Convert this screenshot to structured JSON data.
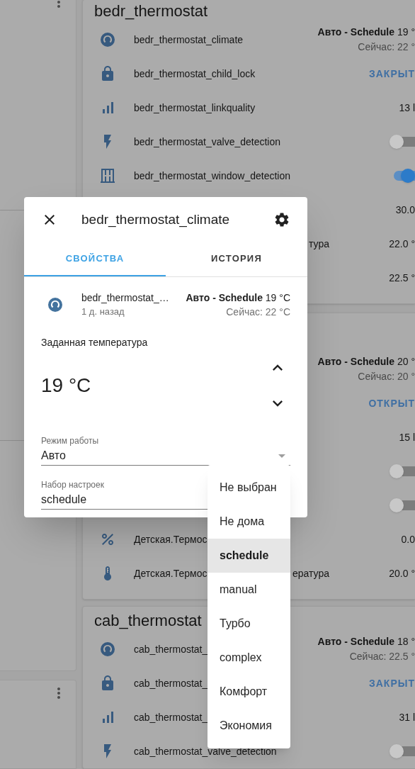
{
  "cards": [
    {
      "title": "bedr_thermostat",
      "rows": [
        {
          "kind": "climate",
          "name": "bedr_thermostat_climate",
          "state": "**Авто - Schedule** 19 °",
          "current": "Сейчас: 22 °"
        },
        {
          "kind": "lock",
          "name": "bedr_thermostat_child_lock",
          "action": "ЗАКРЫТ"
        },
        {
          "kind": "signal",
          "name": "bedr_thermostat_linkquality",
          "value": "13 l"
        },
        {
          "kind": "valve",
          "name": "bedr_thermostat_valve_detection",
          "on": false
        },
        {
          "kind": "window",
          "name": "bedr_thermostat_window_detection",
          "on": true
        },
        {
          "kind": "sensor",
          "value": "30.0"
        },
        {
          "kind": "sensor",
          "name_tail": "тура",
          "value": "22.0 °"
        },
        {
          "kind": "sensor",
          "value": "22.5 °"
        }
      ]
    },
    {
      "rows": [
        {
          "kind": "climate",
          "state": "**Авто - Schedule** 20 °",
          "current": "Сейчас: 20 °"
        },
        {
          "kind": "lock",
          "action": "ОТКРЫТ"
        },
        {
          "kind": "signal",
          "value": "15 l"
        },
        {
          "kind": "valve",
          "on": false
        },
        {
          "kind": "window",
          "on": false
        },
        {
          "kind": "percent",
          "name": "Детская.Термос",
          "value": "0.0"
        },
        {
          "kind": "temperature",
          "name": "Детская.Термос",
          "name_tail": "ература",
          "value": "20.0 °"
        }
      ]
    },
    {
      "title": "cab_thermostat",
      "rows": [
        {
          "kind": "climate",
          "name": "cab_thermostat_",
          "state": "**Авто - Schedule** 18 °",
          "current": "Сейчас: 22.5 °"
        },
        {
          "kind": "lock",
          "name": "cab_thermostat_",
          "action": "ЗАКРЫТ"
        },
        {
          "kind": "signal",
          "name": "cab_thermostat_",
          "value": "31 l"
        },
        {
          "kind": "valve",
          "name": "cab_thermostat_valve_detection",
          "on": false
        }
      ]
    }
  ],
  "dialog": {
    "title": "bedr_thermostat_climate",
    "tabs": [
      {
        "label": "СВОЙСТВА",
        "selected": true
      },
      {
        "label": "ИСТОРИЯ",
        "selected": false
      }
    ],
    "entity": {
      "name": "bedr_thermostat_…",
      "last_changed": "1 д. назад",
      "state": "**Авто - Schedule** 19 °C",
      "current": "Сейчас: 22 °C"
    },
    "target": {
      "label": "Заданная температура",
      "value": "19 °C"
    },
    "selects": [
      {
        "label": "Режим работы",
        "value": "Авто",
        "open": false
      },
      {
        "label": "Набор настроек",
        "value": "schedule",
        "open": true
      }
    ]
  },
  "menu": {
    "items": [
      {
        "label": "Не выбран",
        "selected": false
      },
      {
        "label": "Не дома",
        "selected": false
      },
      {
        "label": "schedule",
        "selected": true
      },
      {
        "label": "manual",
        "selected": false
      },
      {
        "label": "Турбо",
        "selected": false
      },
      {
        "label": "complex",
        "selected": false
      },
      {
        "label": "Комфорт",
        "selected": false
      },
      {
        "label": "Экономия",
        "selected": false
      }
    ]
  }
}
